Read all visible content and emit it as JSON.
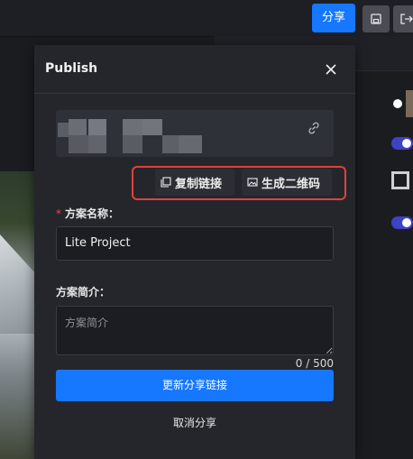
{
  "topbar": {
    "share_label": "分享",
    "save_icon": "save-icon",
    "exit_icon": "exit-icon",
    "accent_color": "#1677ff"
  },
  "publish": {
    "title": "Publish",
    "close_icon": "close-icon",
    "link_icon": "link-icon",
    "copy_link_label": "复制链接",
    "qr_label": "生成二维码",
    "name_label": "方案名称：",
    "name_value": "Lite Project",
    "desc_label": "方案简介：",
    "desc_placeholder": "方案简介",
    "counter": "0 / 500",
    "update_label": "更新分享链接",
    "cancel_label": "取消分享",
    "highlight_color": "#e0423a"
  }
}
